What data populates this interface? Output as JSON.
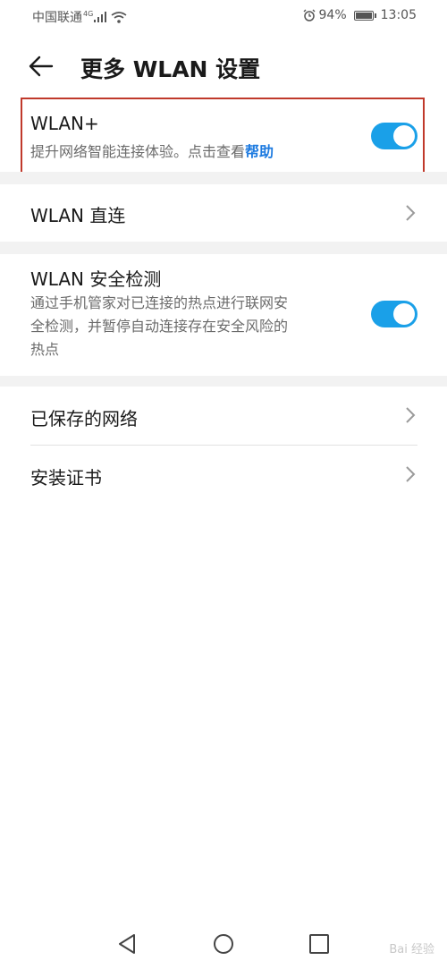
{
  "status_bar": {
    "carrier": "中国联通",
    "network": "4G",
    "battery": "94%",
    "battery_level": 0.94,
    "time": "13:05"
  },
  "header": {
    "title": "更多 WLAN 设置"
  },
  "settings": {
    "wlan_plus": {
      "title": "WLAN+",
      "desc_prefix": "提升网络智能连接体验。点击查看",
      "help_link": "帮助",
      "enabled": true
    },
    "wlan_direct": {
      "title": "WLAN 直连"
    },
    "security_check": {
      "title": "WLAN 安全检测",
      "desc_line1": "通过手机管家对已连接的热点进行联网安",
      "desc_line2": "全检测，并暂停自动连接存在安全风险的",
      "desc_line3": "热点",
      "enabled": true
    },
    "saved_networks": {
      "title": "已保存的网络"
    },
    "install_cert": {
      "title": "安装证书"
    }
  },
  "colors": {
    "accent": "#1aa0e8",
    "link": "#1e7be0",
    "highlight_border": "#c0392b"
  },
  "watermark": "Bai 经验"
}
